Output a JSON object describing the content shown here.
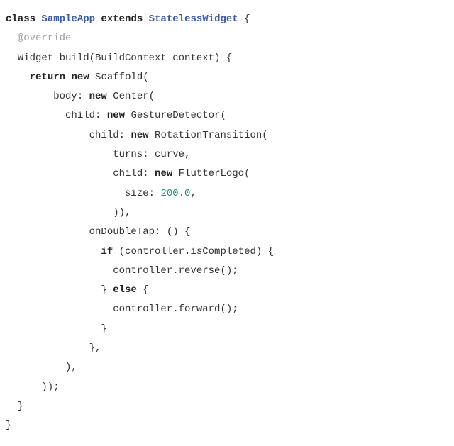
{
  "code": {
    "kw_class": "class",
    "class_name": "SampleApp",
    "kw_extends": "extends",
    "super_class": "StatelessWidget",
    "brace_open": " {",
    "annotation": "@override",
    "line3_prefix": "  Widget build(BuildContext context) {",
    "kw_return": "return",
    "kw_new1": "new",
    "t_scaffold": " Scaffold(",
    "t_body": "        body: ",
    "kw_new2": "new",
    "t_center": " Center(",
    "t_child1": "          child: ",
    "kw_new3": "new",
    "t_gesture": " GestureDetector(",
    "t_child2": "              child: ",
    "kw_new4": "new",
    "t_rotation": " RotationTransition(",
    "t_turns": "                  turns: curve,",
    "t_child3": "                  child: ",
    "kw_new5": "new",
    "t_flutterlogo": " FlutterLogo(",
    "t_size": "                    size: ",
    "num_size": "200.0",
    "t_comma": ",",
    "t_close1": "                  )),",
    "t_ondbl": "              onDoubleTap: () {",
    "kw_if": "if",
    "t_ifcond": " (controller.isCompleted) {",
    "t_reverse": "                  controller.reverse();",
    "t_elseopen": "                } ",
    "kw_else": "else",
    "t_elsebrace": " {",
    "t_forward": "                  controller.forward();",
    "t_close2": "                }",
    "t_close3": "              },",
    "t_close4": "          ),",
    "t_close5": "      ));",
    "t_close6": "  }",
    "t_close7": "}"
  }
}
